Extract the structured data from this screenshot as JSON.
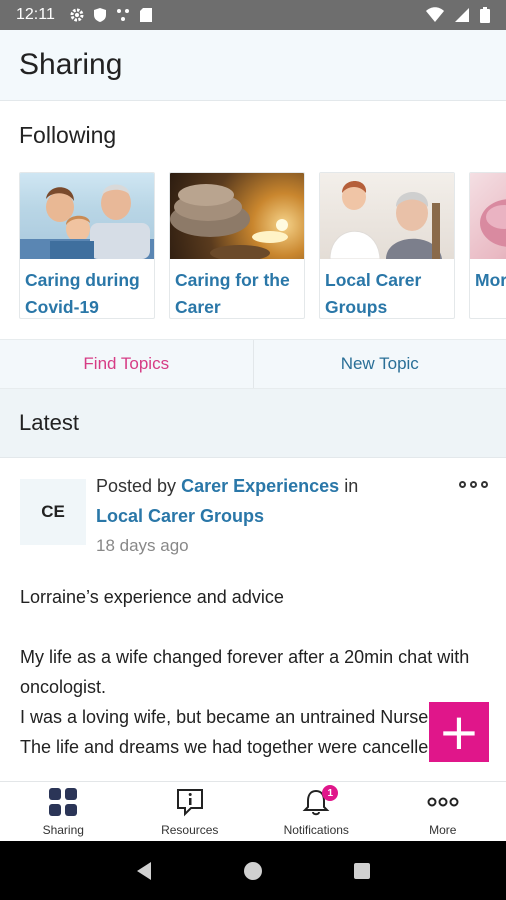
{
  "status_bar": {
    "time": "12:11"
  },
  "app_bar": {
    "title": "Sharing"
  },
  "following": {
    "title": "Following",
    "cards": [
      {
        "label": "Caring during Covid-19"
      },
      {
        "label": "Caring for the Carer"
      },
      {
        "label": "Local Carer Groups"
      },
      {
        "label": "Mor"
      }
    ]
  },
  "topic_tabs": {
    "find": "Find Topics",
    "new": "New Topic"
  },
  "latest": {
    "title": "Latest"
  },
  "post": {
    "avatar": "CE",
    "posted_by_prefix": "Posted by",
    "author": "Carer Experiences",
    "in_text": "in",
    "group": "Local Carer Groups",
    "time_ago": "18 days ago",
    "title": "Lorraine’s experience and advice",
    "lines": [
      "My life as a wife changed forever after a 20min chat with oncologist.",
      "I was a loving wife, but became an untrained Nurse Carer.",
      "The life and dreams we had together were cancelled."
    ]
  },
  "fab": {
    "label": "+"
  },
  "bottom_nav": {
    "sharing": "Sharing",
    "resources": "Resources",
    "notifications": "Notifications",
    "notifications_badge": "1",
    "more": "More"
  },
  "colors": {
    "accent_blue": "#2a77a8",
    "accent_pink": "#e0168a"
  }
}
